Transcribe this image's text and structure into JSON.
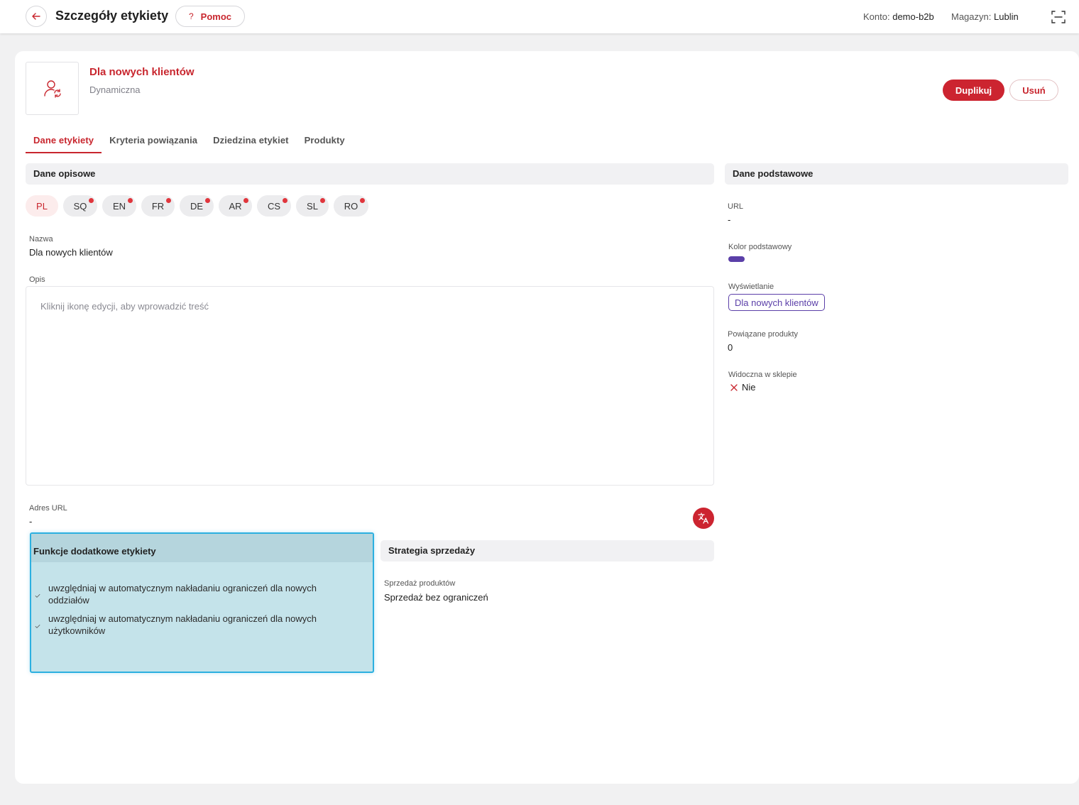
{
  "header": {
    "title": "Szczegóły etykiety",
    "help_label": "Pomoc",
    "help_icon_char": "?",
    "account_label": "Konto:",
    "account_value": "demo-b2b",
    "warehouse_label": "Magazyn:",
    "warehouse_value": "Lublin"
  },
  "label": {
    "name": "Dla nowych klientów",
    "type": "Dynamiczna",
    "duplicate_label": "Duplikuj",
    "delete_label": "Usuń"
  },
  "tabs": [
    {
      "label": "Dane etykiety",
      "active": true
    },
    {
      "label": "Kryteria powiązania",
      "active": false
    },
    {
      "label": "Dziedzina etykiet",
      "active": false
    },
    {
      "label": "Produkty",
      "active": false
    }
  ],
  "descriptive": {
    "section_title": "Dane opisowe",
    "languages": [
      {
        "code": "PL",
        "active": true,
        "missing": false
      },
      {
        "code": "SQ",
        "active": false,
        "missing": true
      },
      {
        "code": "EN",
        "active": false,
        "missing": true
      },
      {
        "code": "FR",
        "active": false,
        "missing": true
      },
      {
        "code": "DE",
        "active": false,
        "missing": true
      },
      {
        "code": "AR",
        "active": false,
        "missing": true
      },
      {
        "code": "CS",
        "active": false,
        "missing": true
      },
      {
        "code": "SL",
        "active": false,
        "missing": true
      },
      {
        "code": "RO",
        "active": false,
        "missing": true
      }
    ],
    "name_label": "Nazwa",
    "name_value": "Dla nowych klientów",
    "description_label": "Opis",
    "description_placeholder": "Kliknij ikonę edycji, aby wprowadzić treść",
    "url_label": "Adres URL",
    "url_value": "-"
  },
  "basic": {
    "section_title": "Dane podstawowe",
    "url_label": "URL",
    "url_value": "-",
    "color_label": "Kolor podstawowy",
    "color_value": "#5b3fa8",
    "display_label": "Wyświetlanie",
    "display_value": "Dla nowych klientów",
    "products_label": "Powiązane produkty",
    "products_value": "0",
    "visible_label": "Widoczna w sklepie",
    "visible_value": "Nie"
  },
  "extra_functions": {
    "section_title": "Funkcje dodatkowe etykiety",
    "items": [
      "uwzględniaj w automatycznym nakładaniu ograniczeń dla nowych oddziałów",
      "uwzględniaj w automatycznym nakładaniu ograniczeń dla nowych użytkowników"
    ]
  },
  "sales_strategy": {
    "section_title": "Strategia sprzedaży",
    "sales_label": "Sprzedaż produktów",
    "sales_value": "Sprzedaż bez ograniczeń"
  },
  "colors": {
    "accent": "#c8262e",
    "label_color": "#5b3fa8",
    "highlight": "#2cb0e0"
  }
}
